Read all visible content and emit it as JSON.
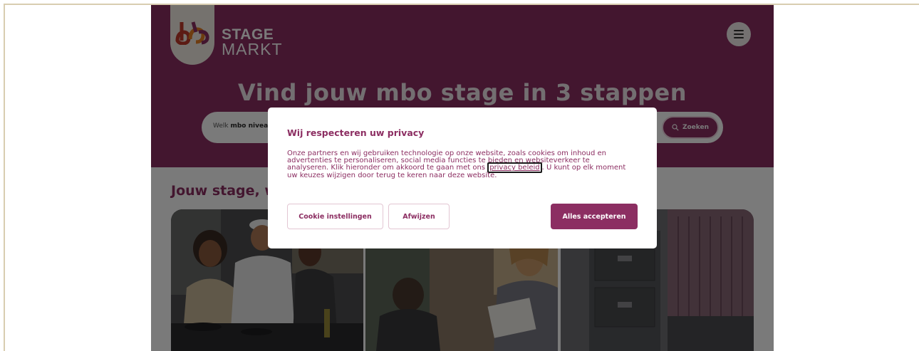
{
  "site": {
    "logo": {
      "line1": "STAGE",
      "line2": "MARKT"
    },
    "hero_title": "Vind jouw mbo stage in 3 stappen",
    "search": {
      "label_prefix": "Welk ",
      "label_bold": "mbo niveau",
      "button_label": "Zoeken"
    },
    "section_title": "Jouw stage, w",
    "icons": {
      "menu": "hamburger-menu-icon",
      "search": "search-icon"
    }
  },
  "cookie_modal": {
    "title": "Wij respecteren uw privacy",
    "text_before_link": "Onze partners en wij gebruiken technologie op onze website, zoals cookies om inhoud en advertenties te personaliseren, social media functies te bieden en websiteverkeer te analyseren. Klik hieronder om akkoord te gaan met ons ",
    "link_text": "privacy beleid",
    "text_after_link": ". U kunt op elk moment uw keuzes wijzigen door terug te keren naar deze website.",
    "buttons": {
      "settings": "Cookie instellingen",
      "reject": "Afwijzen",
      "accept": "Alles accepteren"
    }
  },
  "colors": {
    "brand": "#8c2e62",
    "cream": "#f4efe5"
  }
}
